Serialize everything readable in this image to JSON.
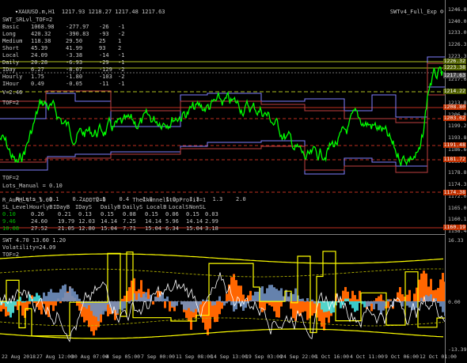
{
  "header": {
    "symbol": "XAUUSD.m,H1",
    "prices": "1217.93 1218.27 1217.48 1217.63",
    "ea_label": "SWTv4_Full_Exp"
  },
  "info": {
    "title": "SWT_SRLvl_TOF=2",
    "rows": [
      {
        "name": "Basic",
        "c1": "1068.98",
        "c2": "-277.97",
        "c3": "-26",
        "c4": "-1"
      },
      {
        "name": "Long",
        "c1": "420.32",
        "c2": "-390.83",
        "c3": "-93",
        "c4": "-2"
      },
      {
        "name": "Medium",
        "c1": "118.38",
        "c2": "29.50",
        "c3": "25",
        "c4": "1"
      },
      {
        "name": "Short",
        "c1": "45.39",
        "c2": "41.99",
        "c3": "93",
        "c4": "2"
      },
      {
        "name": "Local",
        "c1": "24.09",
        "c2": "-3.38",
        "c3": "-14",
        "c4": "-1"
      },
      {
        "name": "Daily",
        "c1": "20.28",
        "c2": "-6.93",
        "c3": "-29",
        "c4": "-1"
      },
      {
        "name": "IDay",
        "c1": "6.27",
        "c2": "-8.07",
        "c3": "-129",
        "c4": "-2"
      },
      {
        "name": "Hourly",
        "c1": "1.75",
        "c2": "-1.80",
        "c3": "-103",
        "c4": "-2"
      },
      {
        "name": "IHour",
        "c1": "0.49",
        "c2": "-0.05",
        "c3": "-11",
        "c4": "-1"
      }
    ],
    "v_label": "V=2.46",
    "tof_label": "TOF=2",
    "tof_label2": "TOF=2"
  },
  "lots": {
    "manual": "Lots_Manual = 0.10",
    "header": "R_Lots_%",
    "values": [
      "0.1",
      "0.2",
      "0.5",
      "0.4",
      "1.0",
      "1.0",
      "1.3",
      "1.3",
      "2.0"
    ],
    "r_aumm": "R_AuMM_% = 1.00",
    "addtl": "ADDTL=0",
    "tcsp": "TheChannelStopProfit=1"
  },
  "sl_table": {
    "headers": [
      "SL_Level",
      "HourlyB",
      "IDayB",
      "IDayS",
      "DailyB",
      "DailyS",
      "LocalB",
      "LocalS",
      "NonSL"
    ],
    "rows": [
      [
        "0.10",
        "0.26",
        "0.21",
        "0.13",
        "0.15",
        "0.08",
        "0.15",
        "0.06",
        "0.15",
        "0.03"
      ],
      [
        "9.46",
        "24.60",
        "19.79",
        "12.03",
        "14.14",
        "7.25",
        "14.14",
        "5.96",
        "14.14",
        "2.99"
      ],
      [
        "10.08",
        "27.52",
        "21.05",
        "12.80",
        "15.04",
        "7.71",
        "15.04",
        "6.34",
        "15.04",
        "3.18"
      ]
    ]
  },
  "sub_indicator": {
    "title": "SWT 4.70 13.60 1.20",
    "volatility": "Volatility=24.09",
    "tof": "TOF=2"
  },
  "price_scale": [
    "1246.80",
    "1240.00",
    "1233.00",
    "1226.32",
    "1223.38",
    "1219.50",
    "1217.63",
    "1214.22",
    "1213.80",
    "1206.80",
    "1199.20",
    "1193.80",
    "1186.60",
    "1185.00",
    "1178.80",
    "1174.38",
    "1172.00",
    "1165.00",
    "1160.19",
    "1158.40"
  ],
  "price_labels": [
    {
      "text": "1226.32",
      "color": "#506000"
    },
    {
      "text": "1223.38",
      "color": "#506000"
    },
    {
      "text": "1217.63",
      "color": "#505050"
    },
    {
      "text": "1214.22",
      "color": "#506000"
    },
    {
      "text": "1208.80",
      "color": "#c03000"
    },
    {
      "text": "1203.62",
      "color": "#c03000"
    },
    {
      "text": "1191.48",
      "color": "#c03000"
    },
    {
      "text": "1181.72",
      "color": "#c03000"
    },
    {
      "text": "1174.38",
      "color": "#c03000"
    },
    {
      "text": "1160.19",
      "color": "#c03000"
    }
  ],
  "sub_scale": [
    "16.33",
    "0.00",
    "-13.39"
  ],
  "date_axis": [
    "22 Aug 2018",
    "27 Aug 12:00",
    "30 Aug 07:00",
    "4 Sep 05:00",
    "7 Sep 00:00",
    "11 Sep 08:00",
    "14 Sep 13:00",
    "19 Sep 03:00",
    "24 Sep 22:00",
    "1 Oct 16:00",
    "4 Oct 11:00",
    "9 Oct 06:00",
    "12 Oct 01:00"
  ],
  "colors": {
    "price": "#00ff00",
    "orange": "#ff6600",
    "cyan": "#40e0e0",
    "slate": "#7090c0",
    "yellow": "#ffff00",
    "red": "#c03020"
  }
}
